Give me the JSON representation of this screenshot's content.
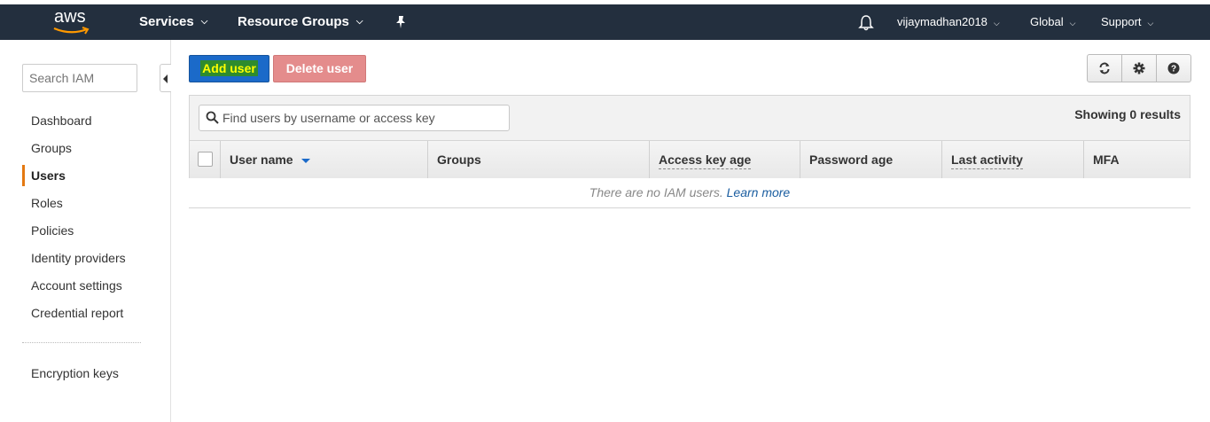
{
  "navbar": {
    "logo_text": "aws",
    "services_label": "Services",
    "resource_groups_label": "Resource Groups",
    "pin_icon": "pin-icon",
    "bell_icon": "bell-icon",
    "username": "vijaymadhan2018",
    "region": "Global",
    "support": "Support",
    "background_color": "#232f3e"
  },
  "sidebar": {
    "search_placeholder": "Search IAM",
    "items": [
      {
        "label": "Dashboard"
      },
      {
        "label": "Groups"
      },
      {
        "label": "Users",
        "active": true
      },
      {
        "label": "Roles"
      },
      {
        "label": "Policies"
      },
      {
        "label": "Identity providers"
      },
      {
        "label": "Account settings"
      },
      {
        "label": "Credential report"
      }
    ],
    "secondary_items": [
      {
        "label": "Encryption keys"
      }
    ],
    "active_color": "#e47911"
  },
  "toolbar": {
    "add_user_label": "Add user",
    "delete_user_label": "Delete user",
    "icons": [
      "refresh-icon",
      "gear-icon",
      "help-icon"
    ]
  },
  "users_table": {
    "filter_placeholder": "Find users by username or access key",
    "results_text": "Showing 0 results",
    "columns": [
      "User name",
      "Groups",
      "Access key age",
      "Password age",
      "Last activity",
      "MFA"
    ],
    "sorted_column": "User name",
    "empty_message": "There are no IAM users.",
    "empty_link": "Learn more"
  }
}
